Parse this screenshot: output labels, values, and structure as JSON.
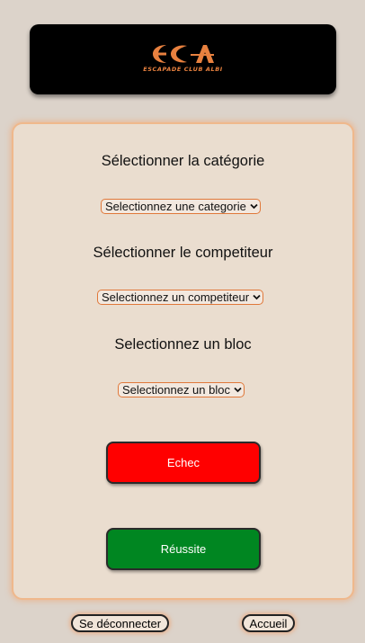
{
  "header": {
    "logo_letters": "ECA",
    "logo_subtitle": "ESCAPADE CLUB ALBI"
  },
  "form": {
    "category_label": "Sélectionner la catégorie",
    "category_select": "Selectionnez une categorie",
    "competitor_label": "Sélectionner le competiteur",
    "competitor_select": "Selectionnez un competiteur",
    "bloc_label": "Selectionnez un bloc",
    "bloc_select": "Selectionnez un bloc"
  },
  "actions": {
    "fail_label": "Echec",
    "success_label": "Réussite"
  },
  "footer": {
    "logout_label": "Se déconnecter",
    "home_label": "Accueil"
  },
  "icons": {
    "select_arrow": "chevron-down-icon"
  },
  "colors": {
    "page_bg": "#dcd3ca",
    "panel_bg": "#eaddcf",
    "accent": "#e0783a",
    "fail": "#ff0000",
    "success": "#008621"
  }
}
